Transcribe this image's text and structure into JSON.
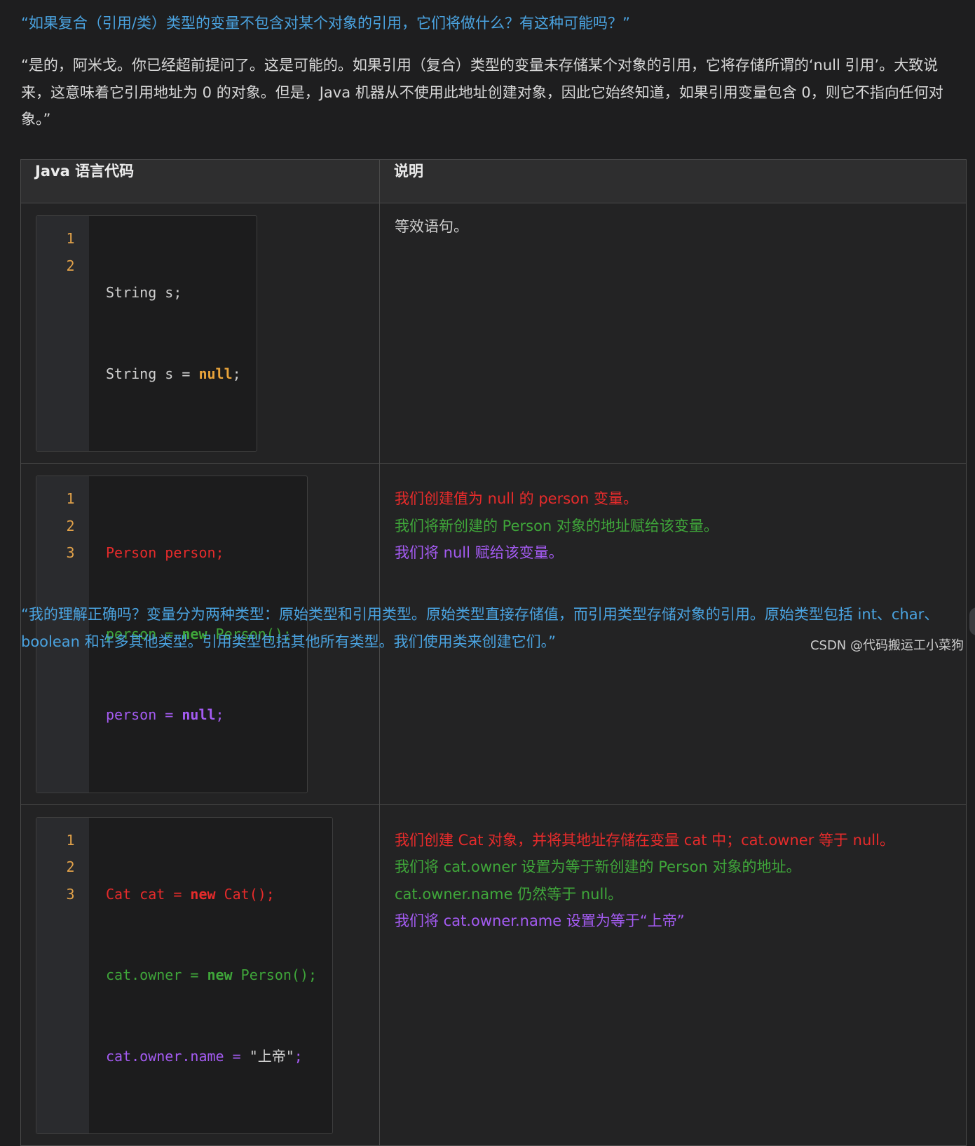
{
  "question1": "“如果复合（引用/类）类型的变量不包含对某个对象的引用，它们将做什么？有这种可能吗？”",
  "answer1": "“是的，阿米戈。你已经超前提问了。这是可能的。如果引用（复合）类型的变量未存储某个对象的引用，它将存储所谓的‘null 引用’。大致说来，这意味着它引用地址为 0 的对象。但是，Java 机器从不使用此地址创建对象，因此它始终知道，如果引用变量包含 0，则它不指向任何对象。”",
  "table": {
    "headers": {
      "code": "Java 语言代码",
      "desc": "说明"
    },
    "row1": {
      "lines": [
        "1",
        "2"
      ],
      "code": {
        "l1": "String s;",
        "l2_pre": "String s = ",
        "l2_null": "null",
        "l2_post": ";"
      },
      "desc": "等效语句。"
    },
    "row2": {
      "lines": [
        "1",
        "2",
        "3"
      ],
      "code": {
        "l1": "Person person;",
        "l2_a": "person = ",
        "l2_new": "new",
        "l2_b": " Person();",
        "l3_a": "person = ",
        "l3_null": "null",
        "l3_b": ";"
      },
      "desc": [
        "我们创建值为 null 的 person 变量。",
        "我们将新创建的 Person 对象的地址赋给该变量。",
        "我们将 null 赋给该变量。"
      ]
    },
    "row3": {
      "lines": [
        "1",
        "2",
        "3"
      ],
      "code": {
        "l1_a": "Cat cat = ",
        "l1_new": "new",
        "l1_b": " Cat();",
        "l2_a": "cat.owner = ",
        "l2_new": "new",
        "l2_b": " Person();",
        "l3_a": "cat.owner.name = ",
        "l3_str": "\"上帝\"",
        "l3_b": ";"
      },
      "desc": [
        "我们创建 Cat 对象，并将其地址存储在变量 cat 中；cat.owner 等于 null。",
        "我们将 cat.owner 设置为等于新创建的 Person 对象的地址。",
        "cat.owner.name 仍然等于 null。",
        "我们将 cat.owner.name 设置为等于“上帝”"
      ]
    }
  },
  "question2": "“我的理解正确吗？变量分为两种类型：原始类型和引用类型。原始类型直接存储值，而引用类型存储对象的引用。原始类型包括 int、char、boolean 和许多其他类型。引用类型包括其他所有类型。我们使用类来创建它们。”",
  "watermark": "CSDN @代码搬运工小菜狗",
  "colors": {
    "link_blue": "#4aa3e0",
    "red": "#e62b2b",
    "green": "#3fa63a",
    "purple": "#a45bf2",
    "number": "#e8a33a"
  }
}
